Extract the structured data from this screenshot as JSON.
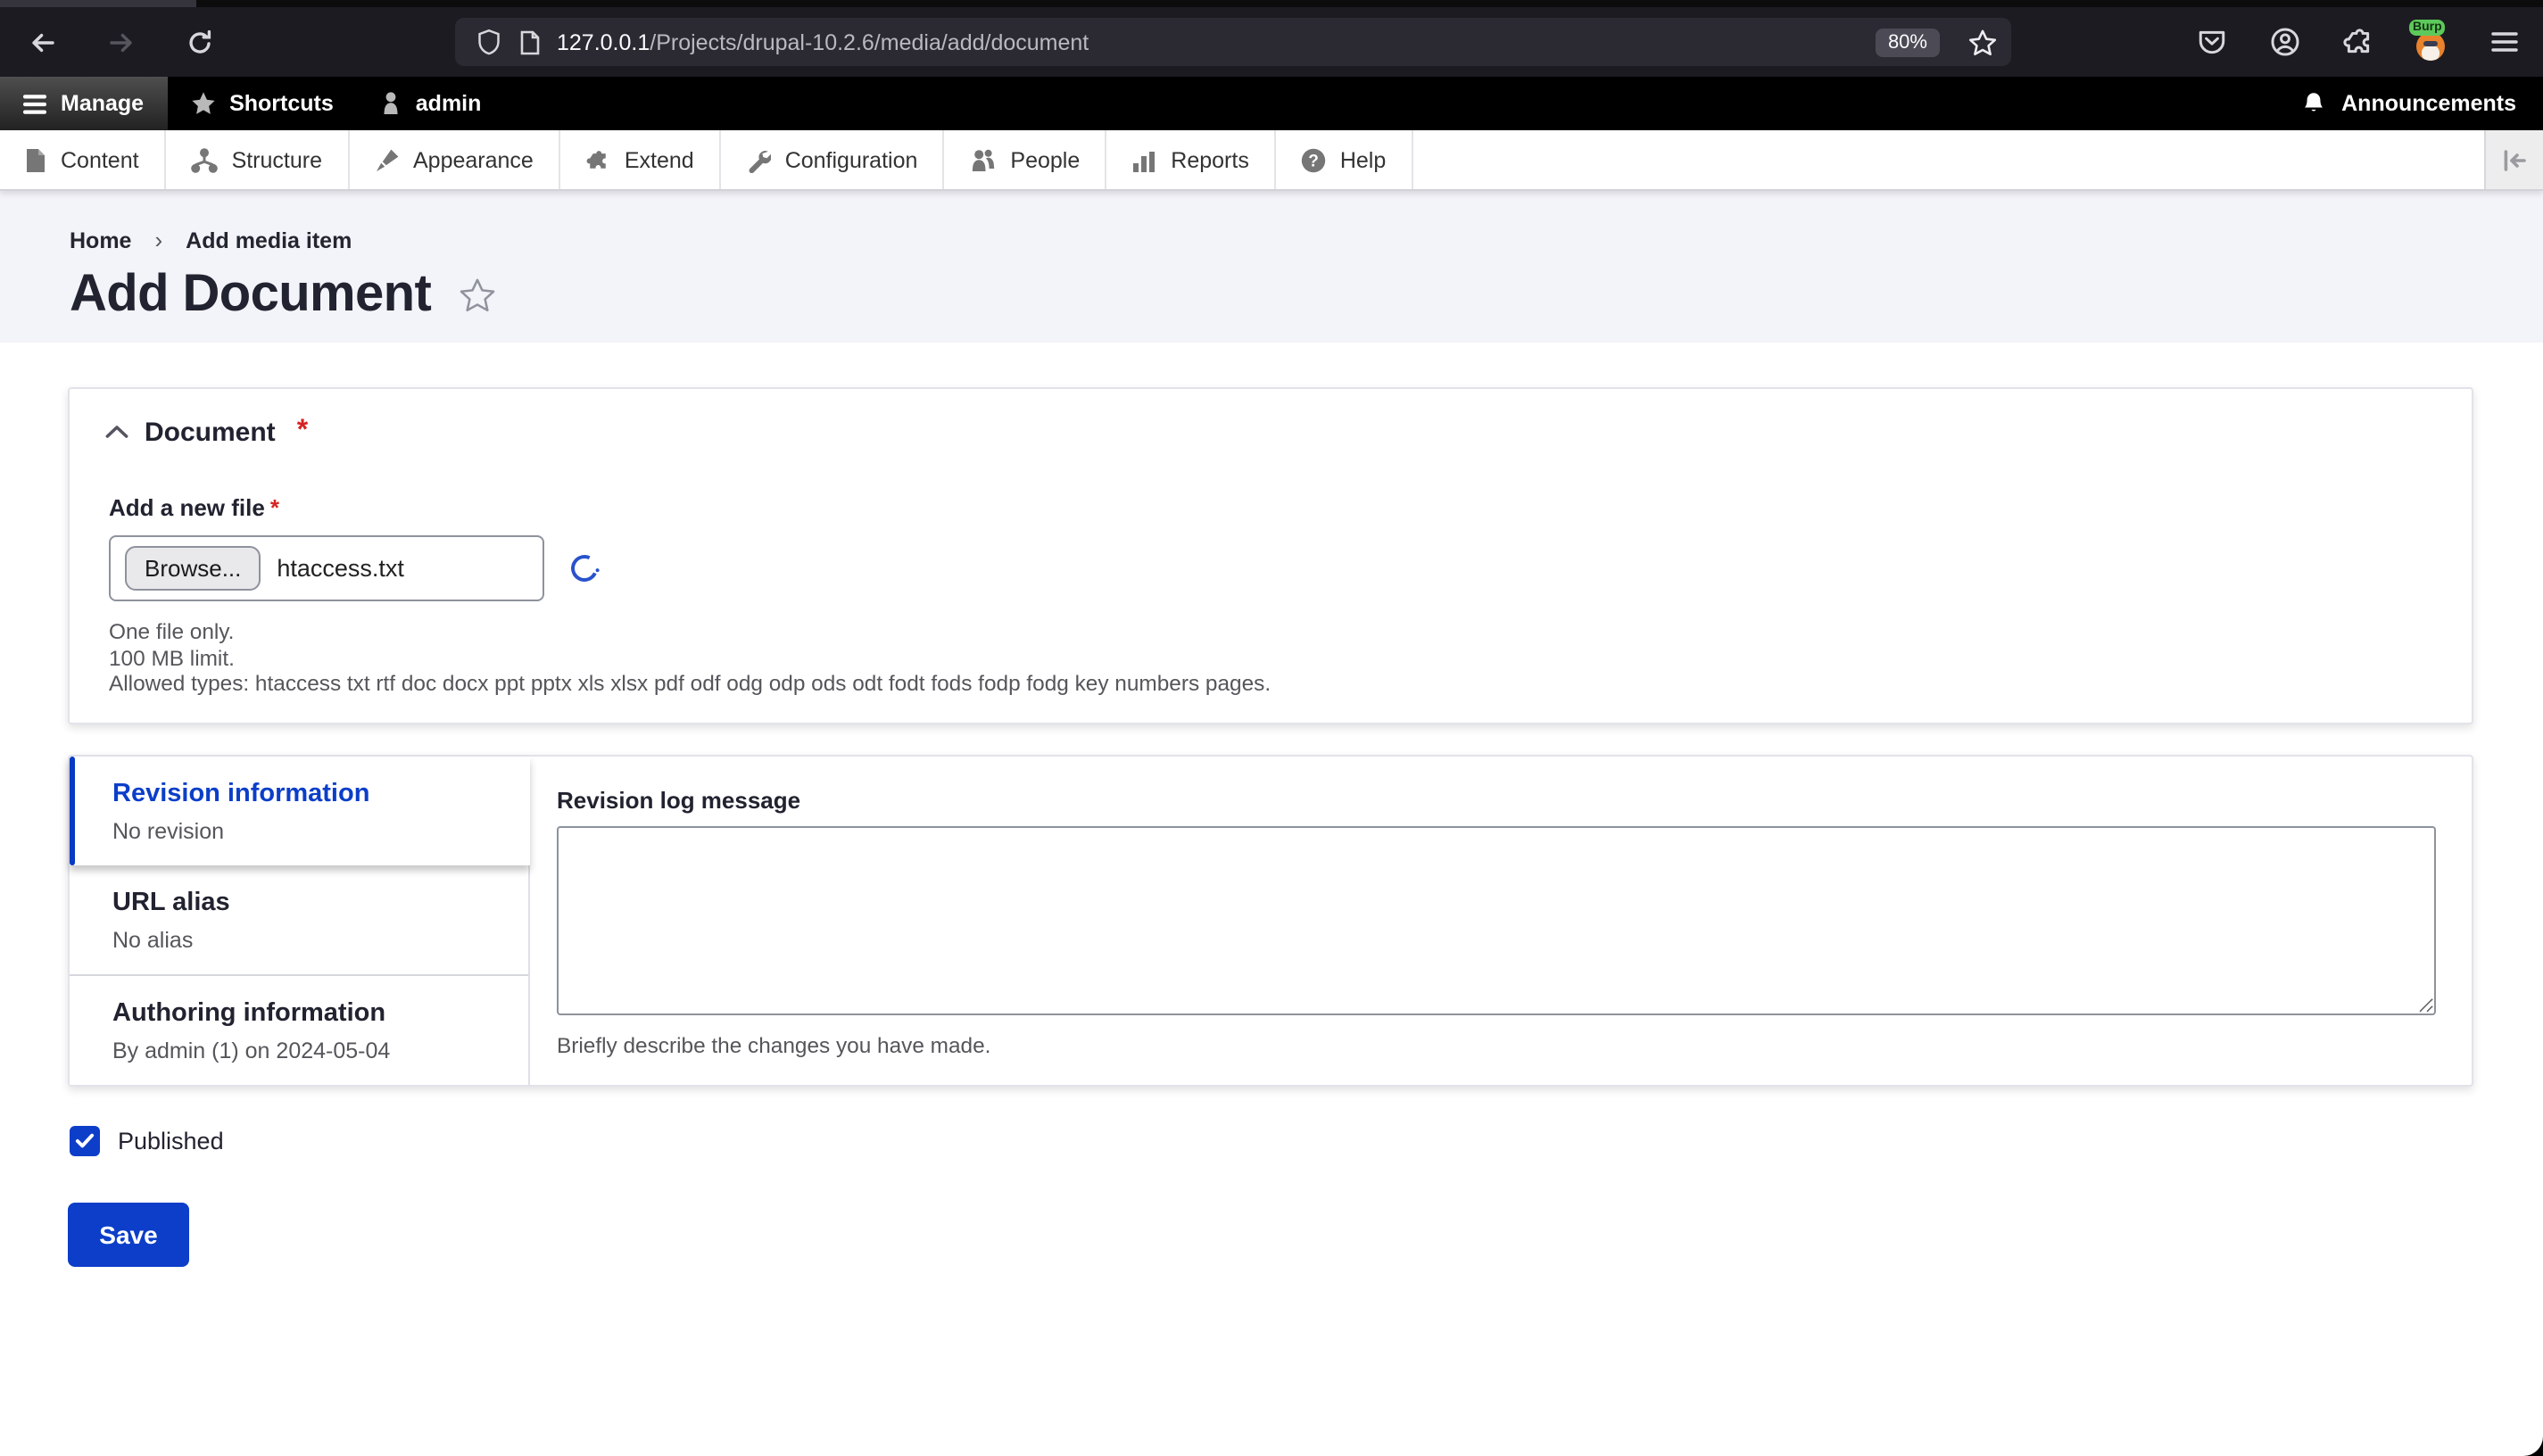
{
  "browser": {
    "url_host": "127.0.0.1",
    "url_path": "/Projects/drupal-10.2.6/media/add/document",
    "zoom_badge": "80%",
    "extension_badge": "Burp"
  },
  "drupal_toolbar": {
    "manage_label": "Manage",
    "shortcuts_label": "Shortcuts",
    "user_label": "admin",
    "announcements_label": "Announcements"
  },
  "admin_menu": {
    "items": [
      {
        "label": "Content",
        "icon": "file-icon"
      },
      {
        "label": "Structure",
        "icon": "sitemap-icon"
      },
      {
        "label": "Appearance",
        "icon": "paintbrush-icon"
      },
      {
        "label": "Extend",
        "icon": "puzzle-icon"
      },
      {
        "label": "Configuration",
        "icon": "wrench-icon"
      },
      {
        "label": "People",
        "icon": "people-icon"
      },
      {
        "label": "Reports",
        "icon": "bar-chart-icon"
      },
      {
        "label": "Help",
        "icon": "question-icon"
      }
    ]
  },
  "breadcrumb": {
    "separator": "›",
    "items": [
      {
        "label": "Home"
      },
      {
        "label": "Add media item"
      }
    ]
  },
  "page": {
    "title": "Add Document"
  },
  "document_section": {
    "legend": "Document",
    "required_marker": "*",
    "file_field": {
      "label": "Add a new file",
      "required_marker": "*",
      "browse_button": "Browse...",
      "filename": "htaccess.txt"
    },
    "help_lines": [
      "One file only.",
      "100 MB limit.",
      "Allowed types: htaccess txt rtf doc docx ppt pptx xls xlsx pdf odf odg odp ods odt fodt fods fodp fodg key numbers pages."
    ]
  },
  "vertical_tabs": {
    "tabs": [
      {
        "title": "Revision information",
        "summary": "No revision",
        "active": true
      },
      {
        "title": "URL alias",
        "summary": "No alias",
        "active": false
      },
      {
        "title": "Authoring information",
        "summary": "By admin (1) on 2024-05-04",
        "active": false
      }
    ]
  },
  "revision_pane": {
    "label": "Revision log message",
    "textarea_value": "",
    "description": "Briefly describe the changes you have made."
  },
  "status_field": {
    "label": "Published",
    "checked": true
  },
  "actions": {
    "save_label": "Save"
  },
  "colors": {
    "accent_blue": "#0d3ec9",
    "required_red": "#d72222",
    "header_bg": "#f3f4f9",
    "toolbar_black": "#000000"
  }
}
